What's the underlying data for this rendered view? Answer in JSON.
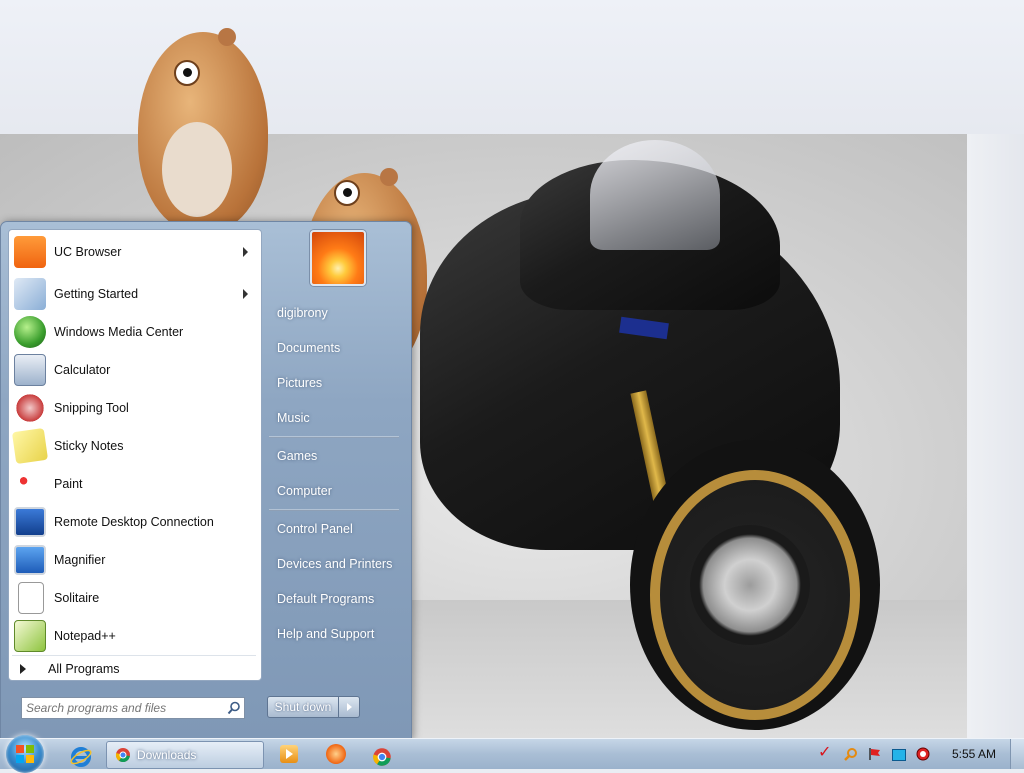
{
  "start_menu": {
    "programs": [
      {
        "label": "UC Browser",
        "icon": "uc-browser-icon",
        "has_submenu": true
      },
      {
        "label": "Getting Started",
        "icon": "getting-started-icon",
        "has_submenu": true
      },
      {
        "label": "Windows Media Center",
        "icon": "windows-media-center-icon",
        "has_submenu": false
      },
      {
        "label": "Calculator",
        "icon": "calculator-icon",
        "has_submenu": false
      },
      {
        "label": "Snipping Tool",
        "icon": "snipping-tool-icon",
        "has_submenu": false
      },
      {
        "label": "Sticky Notes",
        "icon": "sticky-notes-icon",
        "has_submenu": false
      },
      {
        "label": "Paint",
        "icon": "paint-icon",
        "has_submenu": false
      },
      {
        "label": "Remote Desktop Connection",
        "icon": "remote-desktop-icon",
        "has_submenu": false
      },
      {
        "label": "Magnifier",
        "icon": "magnifier-icon",
        "has_submenu": false
      },
      {
        "label": "Solitaire",
        "icon": "solitaire-icon",
        "has_submenu": false
      },
      {
        "label": "Notepad++",
        "icon": "notepad-plus-plus-icon",
        "has_submenu": false
      }
    ],
    "all_programs_label": "All Programs",
    "search_placeholder": "Search programs and files",
    "right_links": [
      {
        "label": "digibrony"
      },
      {
        "label": "Documents"
      },
      {
        "label": "Pictures"
      },
      {
        "label": "Music"
      },
      {
        "label": "Games"
      },
      {
        "label": "Computer"
      },
      {
        "label": "Control Panel"
      },
      {
        "label": "Devices and Printers"
      },
      {
        "label": "Default Programs"
      },
      {
        "label": "Help and Support"
      }
    ],
    "shutdown_label": "Shut down"
  },
  "taskbar": {
    "pinned": [
      "internet-explorer-icon",
      "media-player-icon",
      "uc-browser-icon",
      "chrome-icon"
    ],
    "active_window_label": "Downloads",
    "tray_icons": [
      "vivaldi-icon",
      "search-tool-icon",
      "action-center-flag-icon",
      "display-icon",
      "volume-icon"
    ],
    "clock": "5:55 AM"
  },
  "colors": {
    "menu_frame": "#8ea6c2",
    "taskbar": "#a9bed5",
    "accent_orange": "#ff7b16"
  }
}
